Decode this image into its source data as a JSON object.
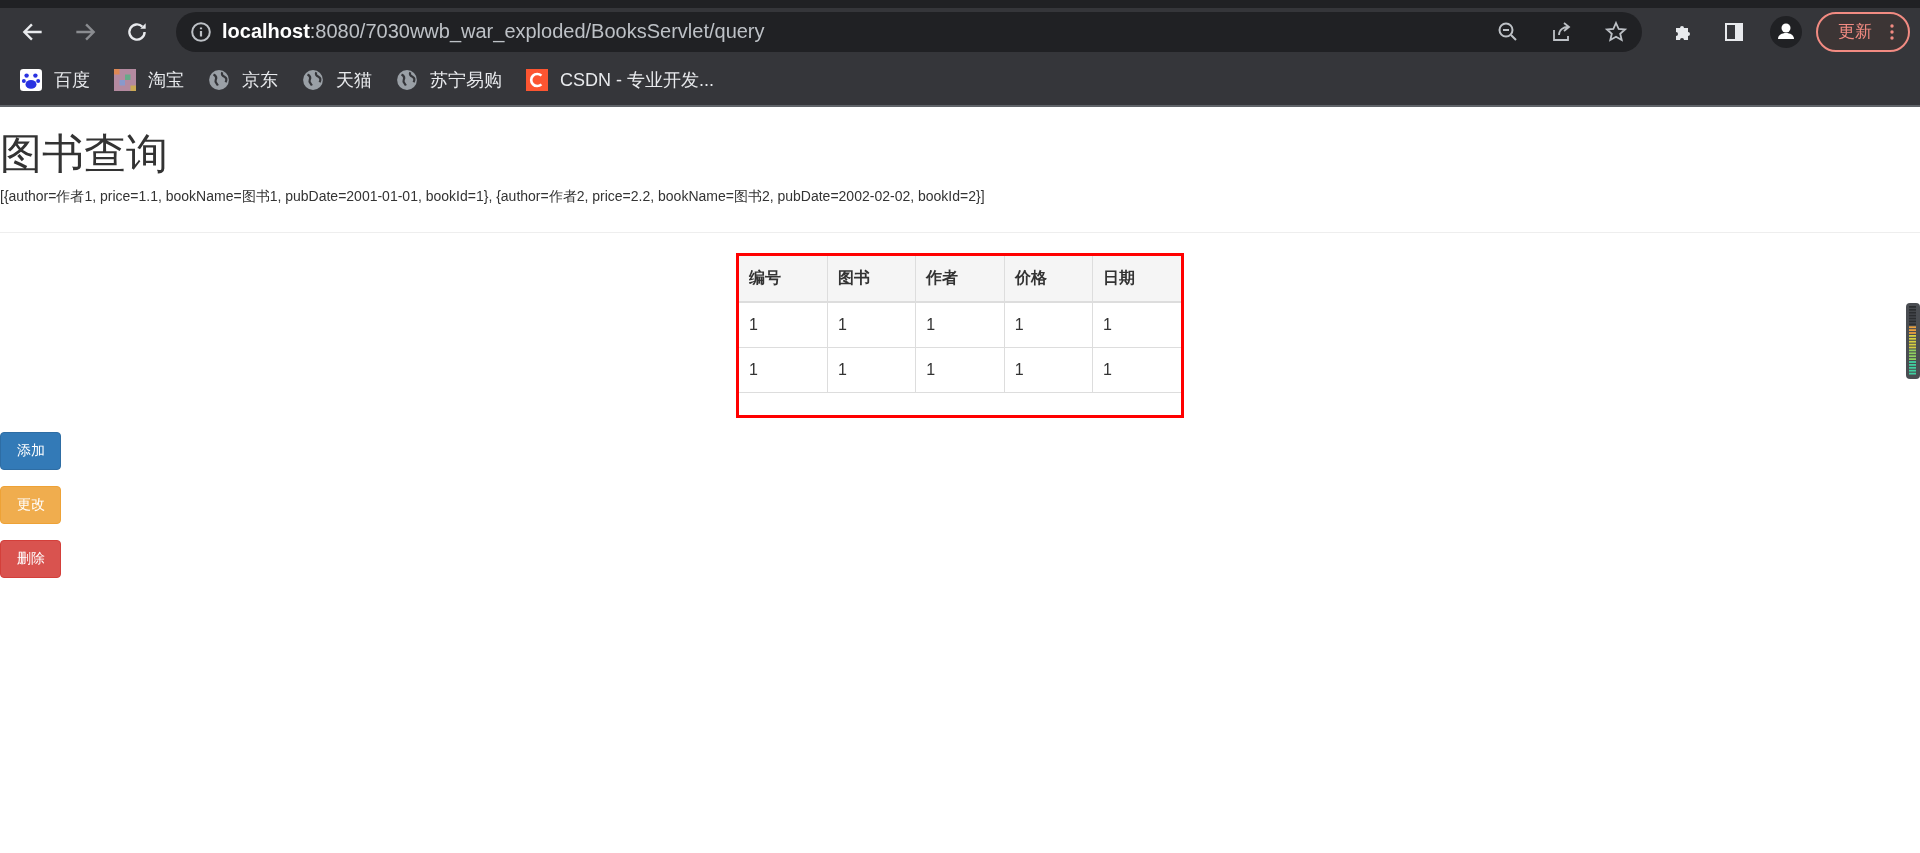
{
  "browser": {
    "url_host": "localhost",
    "url_path": ":8080/7030wwb_war_exploded/BooksServlet/query",
    "update_button": "更新",
    "bookmarks": [
      {
        "label": "百度",
        "kind": "paw"
      },
      {
        "label": "淘宝",
        "kind": "mosaic"
      },
      {
        "label": "京东",
        "kind": "globe"
      },
      {
        "label": "天猫",
        "kind": "globe"
      },
      {
        "label": "苏宁易购",
        "kind": "globe"
      },
      {
        "label": "CSDN - 专业开发...",
        "kind": "letter-c"
      }
    ]
  },
  "page": {
    "title": "图书查询",
    "data_dump": "[{author=作者1, price=1.1, bookName=图书1, pubDate=2001-01-01, bookId=1}, {author=作者2, price=2.2, bookName=图书2, pubDate=2002-02-02, bookId=2}]",
    "table": {
      "columns": [
        "编号",
        "图书",
        "作者",
        "价格",
        "日期"
      ],
      "rows": [
        [
          "1",
          "1",
          "1",
          "1",
          "1"
        ],
        [
          "1",
          "1",
          "1",
          "1",
          "1"
        ]
      ]
    },
    "buttons": [
      {
        "label": "添加",
        "kind": "primary"
      },
      {
        "label": "更改",
        "kind": "warning"
      },
      {
        "label": "删除",
        "kind": "danger"
      }
    ]
  }
}
